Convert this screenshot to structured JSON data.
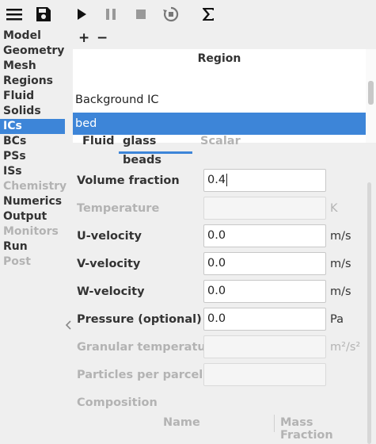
{
  "toolbar": {
    "icons": [
      "menu-icon",
      "save-icon",
      "play-icon",
      "pause-icon",
      "stop-icon",
      "reset-icon",
      "sigma-icon"
    ]
  },
  "sidebar": {
    "items": [
      {
        "label": "Model",
        "state": "normal"
      },
      {
        "label": "Geometry",
        "state": "normal"
      },
      {
        "label": "Mesh",
        "state": "normal"
      },
      {
        "label": "Regions",
        "state": "normal"
      },
      {
        "label": "Fluid",
        "state": "normal"
      },
      {
        "label": "Solids",
        "state": "normal"
      },
      {
        "label": "ICs",
        "state": "active"
      },
      {
        "label": "BCs",
        "state": "normal"
      },
      {
        "label": "PSs",
        "state": "normal"
      },
      {
        "label": "ISs",
        "state": "normal"
      },
      {
        "label": "Chemistry",
        "state": "disabled"
      },
      {
        "label": "Numerics",
        "state": "normal"
      },
      {
        "label": "Output",
        "state": "normal"
      },
      {
        "label": "Monitors",
        "state": "disabled"
      },
      {
        "label": "Run",
        "state": "normal"
      },
      {
        "label": "Post",
        "state": "disabled"
      }
    ]
  },
  "regions": {
    "add_label": "+",
    "remove_label": "−",
    "header": "Region",
    "rows": [
      {
        "label": "Background IC",
        "selected": false
      },
      {
        "label": "bed",
        "selected": true
      }
    ]
  },
  "tabs": [
    {
      "label": "Fluid",
      "state": "normal"
    },
    {
      "label": "glass beads",
      "state": "active"
    },
    {
      "label": "Scalar",
      "state": "disabled"
    }
  ],
  "form": {
    "volume_fraction": {
      "label": "Volume fraction",
      "value": "0.4",
      "unit": ""
    },
    "temperature": {
      "label": "Temperature",
      "value": "",
      "unit": "K"
    },
    "u_velocity": {
      "label": "U-velocity",
      "value": "0.0",
      "unit": "m/s"
    },
    "v_velocity": {
      "label": "V-velocity",
      "value": "0.0",
      "unit": "m/s"
    },
    "w_velocity": {
      "label": "W-velocity",
      "value": "0.0",
      "unit": "m/s"
    },
    "pressure": {
      "label": "Pressure (optional)",
      "value": "0.0",
      "unit": "Pa"
    },
    "granular_temperature": {
      "label": "Granular temperature",
      "value": "",
      "unit": "m²/s²"
    },
    "particles_per_parcel": {
      "label": "Particles per parcel",
      "value": "",
      "unit": ""
    }
  },
  "composition": {
    "label": "Composition",
    "columns": [
      "Name",
      "Mass Fraction"
    ]
  },
  "colors": {
    "accent": "#3d85d8",
    "disabled_text": "#b3b3b3"
  }
}
